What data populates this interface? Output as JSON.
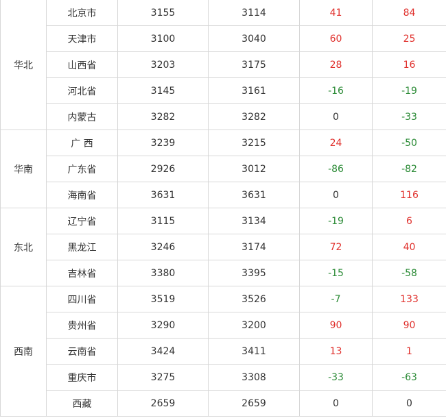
{
  "colors": {
    "positive": "#e0302c",
    "negative": "#2a8a35",
    "neutral": "#333333",
    "border": "#d7d7d7"
  },
  "groups": [
    {
      "region": "华北",
      "rows": [
        {
          "province": "北京市",
          "v1": "3155",
          "v2": "3114",
          "d1": "41",
          "d2": "84"
        },
        {
          "province": "天津市",
          "v1": "3100",
          "v2": "3040",
          "d1": "60",
          "d2": "25"
        },
        {
          "province": "山西省",
          "v1": "3203",
          "v2": "3175",
          "d1": "28",
          "d2": "16"
        },
        {
          "province": "河北省",
          "v1": "3145",
          "v2": "3161",
          "d1": "-16",
          "d2": "-19"
        },
        {
          "province": "内蒙古",
          "v1": "3282",
          "v2": "3282",
          "d1": "0",
          "d2": "-33"
        }
      ]
    },
    {
      "region": "华南",
      "rows": [
        {
          "province": "广 西",
          "v1": "3239",
          "v2": "3215",
          "d1": "24",
          "d2": "-50"
        },
        {
          "province": "广东省",
          "v1": "2926",
          "v2": "3012",
          "d1": "-86",
          "d2": "-82"
        },
        {
          "province": "海南省",
          "v1": "3631",
          "v2": "3631",
          "d1": "0",
          "d2": "116"
        }
      ]
    },
    {
      "region": "东北",
      "rows": [
        {
          "province": "辽宁省",
          "v1": "3115",
          "v2": "3134",
          "d1": "-19",
          "d2": "6"
        },
        {
          "province": "黑龙江",
          "v1": "3246",
          "v2": "3174",
          "d1": "72",
          "d2": "40"
        },
        {
          "province": "吉林省",
          "v1": "3380",
          "v2": "3395",
          "d1": "-15",
          "d2": "-58"
        }
      ]
    },
    {
      "region": "西南",
      "rows": [
        {
          "province": "四川省",
          "v1": "3519",
          "v2": "3526",
          "d1": "-7",
          "d2": "133"
        },
        {
          "province": "贵州省",
          "v1": "3290",
          "v2": "3200",
          "d1": "90",
          "d2": "90"
        },
        {
          "province": "云南省",
          "v1": "3424",
          "v2": "3411",
          "d1": "13",
          "d2": "1"
        },
        {
          "province": "重庆市",
          "v1": "3275",
          "v2": "3308",
          "d1": "-33",
          "d2": "-63"
        },
        {
          "province": "西藏",
          "v1": "2659",
          "v2": "2659",
          "d1": "0",
          "d2": "0"
        }
      ]
    }
  ]
}
